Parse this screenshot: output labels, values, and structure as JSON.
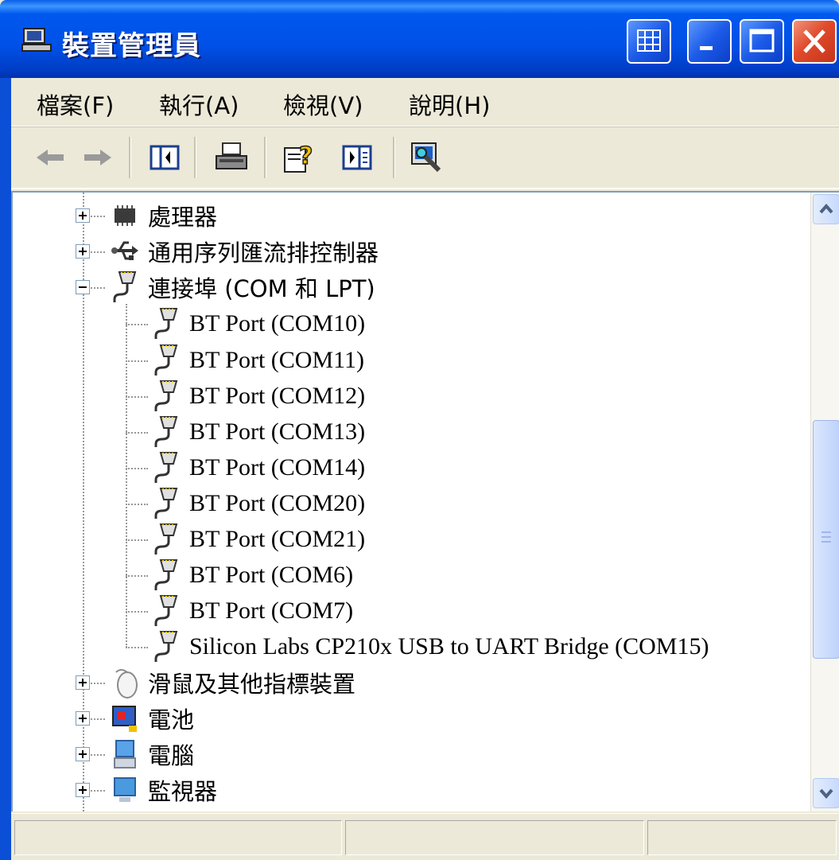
{
  "window": {
    "title": "裝置管理員",
    "accent": "#0054e3",
    "buttons": [
      "window-menu",
      "minimize",
      "maximize",
      "close"
    ]
  },
  "menu": {
    "items": [
      "檔案(F)",
      "執行(A)",
      "檢視(V)",
      "說明(H)"
    ]
  },
  "toolbar": {
    "icons": [
      "back-arrow-icon",
      "forward-arrow-icon",
      "show-hide-tree-icon",
      "print-icon",
      "help-icon",
      "properties-icon",
      "scan-hardware-icon"
    ]
  },
  "tree": {
    "nodes": [
      {
        "label": "處理器",
        "icon": "processor-icon",
        "state": "collapsed"
      },
      {
        "label": "通用序列匯流排控制器",
        "icon": "usb-icon",
        "state": "collapsed"
      },
      {
        "label": "連接埠 (COM 和 LPT)",
        "icon": "port-icon",
        "state": "expanded",
        "children": [
          "BT Port (COM10)",
          "BT Port (COM11)",
          "BT Port (COM12)",
          "BT Port (COM13)",
          "BT Port (COM14)",
          "BT Port (COM20)",
          "BT Port (COM21)",
          "BT Port (COM6)",
          "BT Port (COM7)",
          "Silicon Labs CP210x USB to UART Bridge (COM15)"
        ]
      },
      {
        "label": "滑鼠及其他指標裝置",
        "icon": "mouse-icon",
        "state": "collapsed"
      },
      {
        "label": "電池",
        "icon": "battery-icon",
        "state": "collapsed"
      },
      {
        "label": "電腦",
        "icon": "computer-icon",
        "state": "collapsed"
      },
      {
        "label": "監視器",
        "icon": "monitor-icon",
        "state": "collapsed"
      }
    ]
  },
  "scrollbar": {
    "position": 0.55
  }
}
